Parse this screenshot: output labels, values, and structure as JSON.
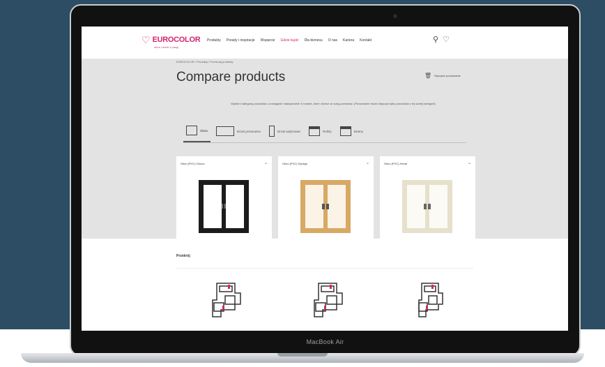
{
  "device": {
    "label": "MacBook Air"
  },
  "site": {
    "logo": "EUROCOLOR",
    "logo_tagline": "okna i drzwi z pasją",
    "nav": [
      "Produkty",
      "Porady i inspiracje",
      "Wsparcie",
      "Gdzie kupić",
      "Dla biznesu",
      "O nas",
      "Kariera",
      "Kontakt"
    ],
    "nav_accent_index": 3,
    "breadcrumb": "EUROCOLOR / Produkty / Porównaj produkty",
    "title": "Compare products",
    "clear_label": "Wyczyść porównanie",
    "instructions": "Wybierz kategorię produktów, a następnie maksymalnie 3 modele, które chcesz ze sobą porównać. (Porównanie może dotyczyć tylko produktów z tej samej kategorii)",
    "tabs": [
      {
        "label": "Okna",
        "icon": "window-icon"
      },
      {
        "label": "Drzwi przesuwne",
        "icon": "sliding-door-icon"
      },
      {
        "label": "Drzwi wejściowe",
        "icon": "entrance-door-icon"
      },
      {
        "label": "Rolety",
        "icon": "roller-blind-icon"
      },
      {
        "label": "Bramy",
        "icon": "garage-door-icon"
      }
    ],
    "active_tab": 0,
    "cards": [
      {
        "name": "Okno (PVC) Genzo",
        "frame_color": "#1c1c1c",
        "glass": "#ffffff"
      },
      {
        "name": "Okno (PVC) Synego",
        "frame_color": "#d7a965",
        "glass": "#fbf3e6"
      },
      {
        "name": "Okno (PVC) Hexal",
        "frame_color": "#e6e0cc",
        "glass": "#fbfaf4"
      }
    ],
    "section_label": "Przekrój",
    "colors": {
      "accent": "#d6246e",
      "grey_band": "#e3e3e4",
      "background": "#2c4d63"
    }
  }
}
